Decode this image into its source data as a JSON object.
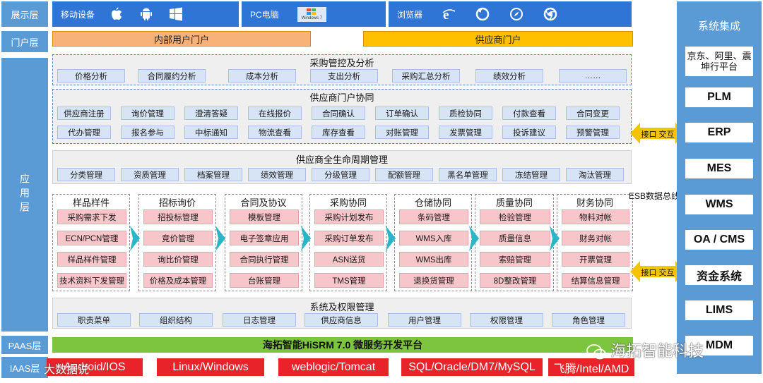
{
  "layers": {
    "display": "展示层",
    "portal": "门户层",
    "app": "应用层",
    "paas": "PAAS层",
    "iaas": "IAAS层"
  },
  "display": {
    "mobile_label": "移动设备",
    "pc_label": "PC电脑",
    "windows7_text": "Windows 7",
    "browser_label": "浏览器"
  },
  "portals": {
    "internal": "内部用户门户",
    "supplier": "供应商门户"
  },
  "procurement_control": {
    "title": "采购管控及分析",
    "items": [
      "价格分析",
      "合同履约分析",
      "成本分析",
      "支出分析",
      "采购汇总分析",
      "绩效分析",
      "……"
    ]
  },
  "supplier_portal": {
    "title": "供应商门户协同",
    "row1": [
      "供应商注册",
      "询价管理",
      "澄清答疑",
      "在线报价",
      "合同确认",
      "订单确认",
      "质检协同",
      "付款查看",
      "合同变更"
    ],
    "row2": [
      "代办管理",
      "报名参与",
      "中标通知",
      "物流查看",
      "库存查看",
      "对账管理",
      "发票管理",
      "投诉建议",
      "预警管理"
    ]
  },
  "lifecycle": {
    "title": "供应商全生命周期管理",
    "items": [
      "分类管理",
      "资质管理",
      "档案管理",
      "绩效管理",
      "分级管理",
      "配额管理",
      "黑名单管理",
      "冻结管理",
      "淘汰管理"
    ]
  },
  "modules": [
    {
      "title": "样品样件",
      "items": [
        "采购需求下发",
        "ECN/PCN管理",
        "样品样件管理",
        "技术资料下发管理"
      ]
    },
    {
      "title": "招标询价",
      "items": [
        "招投标管理",
        "竞价管理",
        "询比价管理",
        "价格及成本管理"
      ]
    },
    {
      "title": "合同及协议",
      "items": [
        "模板管理",
        "电子签章应用",
        "合同执行管理",
        "台账管理"
      ]
    },
    {
      "title": "采购协同",
      "items": [
        "采购计划发布",
        "采购订单发布",
        "ASN送货",
        "TMS管理"
      ]
    },
    {
      "title": "仓储协同",
      "items": [
        "条码管理",
        "WMS入库",
        "WMS出库",
        "退换货管理"
      ]
    },
    {
      "title": "质量协同",
      "items": [
        "检验管理",
        "质量信息",
        "索赔管理",
        "8D整改管理"
      ]
    },
    {
      "title": "财务协同",
      "items": [
        "物料对帐",
        "财务对帐",
        "开票管理",
        "结算信息管理"
      ]
    }
  ],
  "sys_admin": {
    "title": "系统及权限管理",
    "items": [
      "职责菜单",
      "组织结构",
      "日志管理",
      "供应商信息",
      "用户管理",
      "权限管理",
      "角色管理"
    ]
  },
  "platform": "海拓智能HiSRM 7.0 微服务开发平台",
  "iaas_items": [
    "Android/IOS",
    "Linux/Windows",
    "weblogic/Tomcat",
    "SQL/Oracle/DM7/MySQL",
    "飞腾/Intel/AMD"
  ],
  "integration": {
    "title": "系统集成",
    "items": [
      "京东、阿里、震坤行平台",
      "PLM",
      "ERP",
      "MES",
      "WMS",
      "OA / CMS",
      "资金系统",
      "LIMS",
      "MDM"
    ]
  },
  "connectors": {
    "interface1": "接口 交互",
    "esb": "ESB数据总线",
    "interface2": "接口 交互"
  },
  "watermarks": {
    "brand": "海拓智能科技",
    "source": "大数据说"
  },
  "colors": {
    "layer_blue": "#5b9bd5",
    "display_blue": "#2e75d6",
    "portal_internal": "#f7b27a",
    "portal_supplier": "#ffc000",
    "chip_blue": "#d6e4f5",
    "module_pink": "#f7c6cb",
    "platform_green": "#7ec53f",
    "iaas_red": "#e8232a",
    "arrow_cyan": "#2bb5c8",
    "connector_yellow": "#f5c400"
  }
}
